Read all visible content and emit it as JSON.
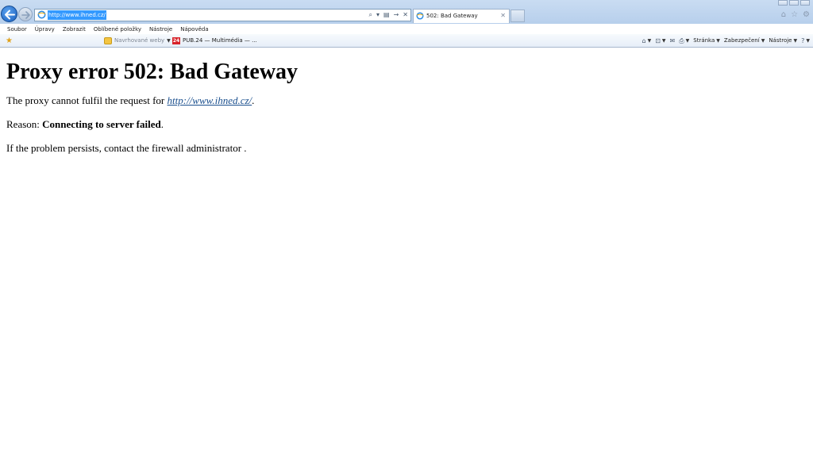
{
  "browser": {
    "address_url": "http://www.ihned.cz/",
    "tab_title": "502: Bad Gateway",
    "menu": [
      "Soubor",
      "Úpravy",
      "Zobrazit",
      "Oblíbené položky",
      "Nástroje",
      "Nápověda"
    ],
    "favorites": {
      "suggested_sites": "Navrhované weby",
      "pub_icon_text": "24",
      "pub_link": "PUB.24 — Multimédia — ..."
    },
    "command_bar": {
      "page": "Stránka",
      "safety": "Zabezpečení",
      "tools": "Nástroje"
    }
  },
  "page": {
    "heading": "Proxy error 502: Bad Gateway",
    "line1_prefix": "The proxy cannot fulfil the request for ",
    "line1_link": "http://www.ihned.cz/",
    "line1_suffix": ".",
    "line2_prefix": "Reason: ",
    "line2_bold": "Connecting to server failed",
    "line2_suffix": ".",
    "line3": "If the problem persists, contact the firewall administrator ."
  }
}
